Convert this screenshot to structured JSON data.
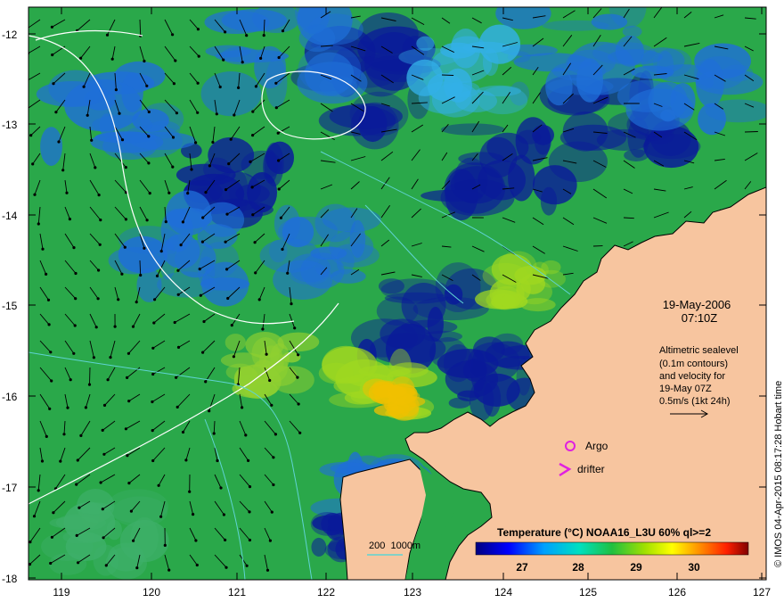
{
  "map": {
    "lon_ticks": [
      "119",
      "120",
      "121",
      "122",
      "123",
      "124",
      "125",
      "126",
      "127"
    ],
    "lat_ticks": [
      "-12",
      "-13",
      "-14",
      "-15",
      "-16",
      "-17",
      "-18"
    ],
    "date_line1": "19-May-2006",
    "date_line2": "07:10Z",
    "info_lines": [
      "Altimetric sealevel",
      "(0.1m contours)",
      "and velocity for",
      "19-May 07Z",
      "0.5m/s (1kt 24h)"
    ],
    "argo_label": "Argo",
    "drifter_label": "drifter",
    "depth_label": "200  1000m",
    "colorbar_title": "Temperature (°C) NOAA16_L3U 60% ql>=2",
    "colorbar_ticks": [
      "27",
      "28",
      "29",
      "30"
    ],
    "credit": "© IMOS 04-Apr-2015 08:17:28 Hobart time",
    "colors": {
      "land": "#f7c59f",
      "sea_base": "#2aa84a",
      "argo": "#e020e0",
      "depth_contour": "#5fd3d3"
    }
  }
}
